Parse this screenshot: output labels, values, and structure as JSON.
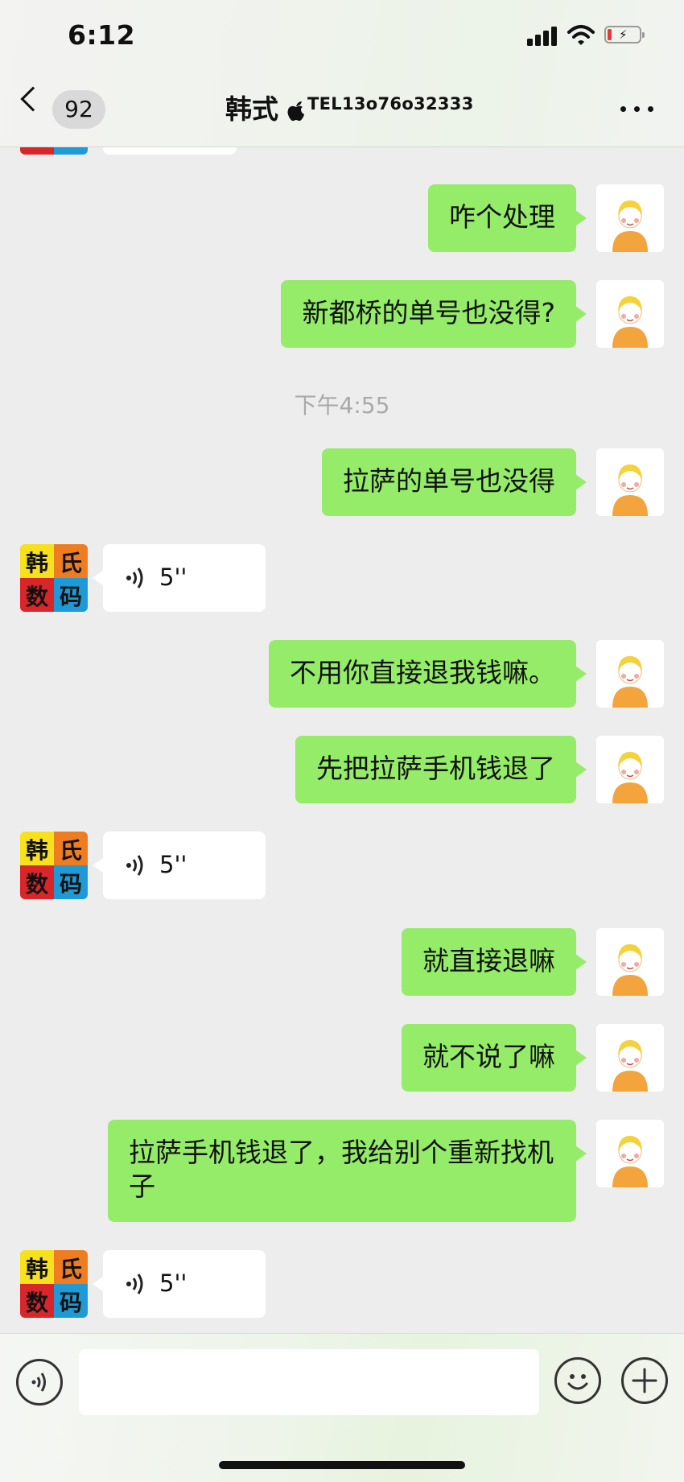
{
  "status_bar": {
    "time": "6:12"
  },
  "header": {
    "back_count": "92",
    "title": "韩式",
    "tel": "TEL13o76o32333"
  },
  "messages": [
    {
      "side": "out",
      "text": "咋个处理"
    },
    {
      "side": "out",
      "text": "新都桥的单号也没得?"
    },
    {
      "type": "time",
      "text": "下午4:55"
    },
    {
      "side": "out",
      "text": "拉萨的单号也没得"
    },
    {
      "side": "in",
      "type": "voice",
      "duration": "5''"
    },
    {
      "side": "out",
      "text": "不用你直接退我钱嘛。"
    },
    {
      "side": "out",
      "text": "先把拉萨手机钱退了"
    },
    {
      "side": "in",
      "type": "voice",
      "duration": "5''"
    },
    {
      "side": "out",
      "text": "就直接退嘛"
    },
    {
      "side": "out",
      "text": "就不说了嘛"
    },
    {
      "side": "out",
      "text": "拉萨手机钱退了，我给别个重新找机子"
    },
    {
      "side": "in",
      "type": "voice",
      "duration": "5''"
    }
  ],
  "shop_avatar": {
    "chars": [
      "韩",
      "氏",
      "数",
      "码"
    ],
    "colors": [
      "#f7e01c",
      "#ee7d22",
      "#d9262a",
      "#1e9ad6"
    ]
  },
  "colors": {
    "bubble_out": "#95ec69",
    "bubble_in": "#ffffff",
    "background": "#ededed"
  }
}
